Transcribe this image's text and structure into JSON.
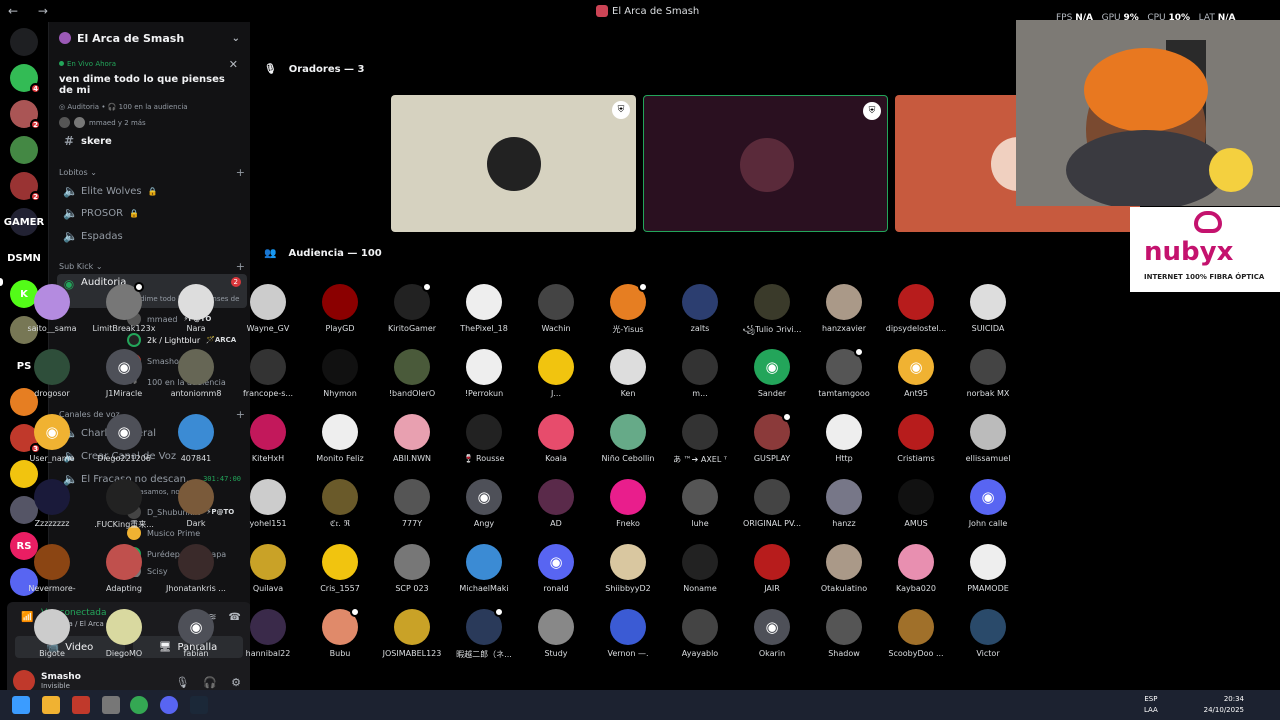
{
  "titlebar": {
    "title": "El Arca de Smash",
    "fps_label": "FPS",
    "fps_value": "N/A",
    "gpu_label": "GPU",
    "gpu_value": "9%",
    "cpu_label": "CPU",
    "cpu_value": "10%",
    "lat_label": "LAT",
    "lat_value": "N/A"
  },
  "servers": [
    {
      "abbr": "",
      "color": "#1e1f22",
      "badge": ""
    },
    {
      "abbr": "",
      "color": "#3b5",
      "badge": "4"
    },
    {
      "abbr": "",
      "color": "#a55",
      "badge": "2"
    },
    {
      "abbr": "",
      "color": "#484",
      "badge": ""
    },
    {
      "abbr": "",
      "color": "#933",
      "badge": "2"
    },
    {
      "abbr": "GAMER",
      "color": "#223",
      "badge": ""
    },
    {
      "abbr": "DSMN",
      "color": "#000",
      "badge": ""
    },
    {
      "abbr": "K",
      "color": "#53fc18",
      "badge": ""
    },
    {
      "abbr": "",
      "color": "#775",
      "badge": ""
    },
    {
      "abbr": "PS",
      "color": "#000",
      "badge": ""
    },
    {
      "abbr": "",
      "color": "#e67e22",
      "badge": ""
    },
    {
      "abbr": "",
      "color": "#c0392b",
      "badge": "3"
    },
    {
      "abbr": "",
      "color": "#f1c40f",
      "badge": ""
    },
    {
      "abbr": "",
      "color": "#556",
      "badge": ""
    },
    {
      "abbr": "RS",
      "color": "#e91e63",
      "badge": ""
    },
    {
      "abbr": "",
      "color": "#5865f2",
      "badge": ""
    },
    {
      "abbr": "",
      "color": "#8a6",
      "badge": ""
    }
  ],
  "guild": {
    "name": "El Arca de Smash"
  },
  "stage": {
    "live_label": "En Vivo Ahora",
    "topic": "ven dime todo lo que pienses de mi",
    "meta_channel": "Auditoria",
    "meta_audience": "100 en la audiencia",
    "users": "mmaed y 2 más"
  },
  "channels": {
    "skere": "skere",
    "cat_lobitos": "Lobitos",
    "elite": "Elite Wolves",
    "prosor": "PROSOR",
    "espadas": "Espadas",
    "cat_subkick": "Sub Kick",
    "auditoria": "Auditoria",
    "auditoria_count": "2",
    "auditoria_sub": "ven dime todo lo que pienses de mi",
    "m1_name": "mmaed",
    "m1_tag": "P@TO",
    "m2_name": "2k / Lightblur",
    "m2_tag": "ARCA",
    "m3_name": "Smasho",
    "m4_name": "100 en la audiencia",
    "cat_voz": "Canales de voz",
    "charla": "Charla General",
    "crear": "Crear Canal de Voz",
    "fracaso": "El Fracaso no descan...",
    "fracaso_time": "301:47:00",
    "fracaso_sub": "Fracasamos, no hay ATV",
    "v1_name": "D_ShubunkiN",
    "v1_tag": "P@TO",
    "v2_name": "Musico Prime",
    "v3_name": "Purédepapasinpapa",
    "v4_name": "Scisy"
  },
  "voice_panel": {
    "status": "Voz conectada",
    "location": "Auditoria / El Arca de Smash",
    "video": "Video",
    "screen": "Pantalla",
    "username": "Smasho",
    "user_status": "Invisible"
  },
  "main": {
    "speakers_header": "Oradores — 3",
    "audience_header": "Audiencia — 100",
    "speaker_tiles": [
      {
        "bg": "#d6d2c0",
        "avatar": "#222",
        "border": "none"
      },
      {
        "bg": "#2a1020",
        "avatar": "#5a2a3a",
        "border": "#23a55a"
      },
      {
        "bg": "#c75a3e",
        "avatar": "#f0d0c0",
        "border": "none"
      }
    ],
    "logo_name": "nubyx",
    "logo_tag": "INTERNET 100% FIBRA ÓPTICA"
  },
  "audience": [
    {
      "name": "saito__sama",
      "color": "#b48be0",
      "discord": false,
      "mark": false
    },
    {
      "name": "LimitBreak123x",
      "color": "#777",
      "discord": false,
      "mark": true
    },
    {
      "name": "Nara",
      "color": "#ddd",
      "discord": false,
      "mark": false
    },
    {
      "name": "Wayne_GV",
      "color": "#ccc",
      "discord": false,
      "mark": false
    },
    {
      "name": "PlayGD",
      "color": "#8b0000",
      "discord": false,
      "mark": false
    },
    {
      "name": "KiritoGamer",
      "color": "#222",
      "discord": false,
      "mark": true
    },
    {
      "name": "ThePixel_18",
      "color": "#eee",
      "discord": false,
      "mark": false
    },
    {
      "name": "Wachin",
      "color": "#444",
      "discord": false,
      "mark": false
    },
    {
      "name": "光-Yisus",
      "color": "#e67e22",
      "discord": false,
      "mark": true
    },
    {
      "name": "zalts",
      "color": "#2c3e70",
      "discord": false,
      "mark": false
    },
    {
      "name": "꧁Tulio ℑrivi...",
      "color": "#3a3a2a",
      "discord": false,
      "mark": false
    },
    {
      "name": "hanzxavier",
      "color": "#a98",
      "discord": false,
      "mark": false
    },
    {
      "name": "dipsydelostel...",
      "color": "#b71c1c",
      "discord": false,
      "mark": false
    },
    {
      "name": "SUICIDA",
      "color": "#ddd",
      "discord": false,
      "mark": false
    },
    {
      "name": "drogosor",
      "color": "#2e4e3a",
      "discord": false,
      "mark": false
    },
    {
      "name": "J1Miracle",
      "color": "#4e5058",
      "discord": true,
      "mark": false
    },
    {
      "name": "antoniomm8",
      "color": "#665",
      "discord": false,
      "mark": false
    },
    {
      "name": "francope-s...",
      "color": "#333",
      "discord": false,
      "mark": false
    },
    {
      "name": "Nhymon",
      "color": "#111",
      "discord": false,
      "mark": false
    },
    {
      "name": "!bandOlerO",
      "color": "#4a5a3a",
      "discord": false,
      "mark": false
    },
    {
      "name": "!Perrokun",
      "color": "#eee",
      "discord": false,
      "mark": false
    },
    {
      "name": "J...",
      "color": "#f1c40f",
      "discord": false,
      "mark": false
    },
    {
      "name": "Ken",
      "color": "#ddd",
      "discord": false,
      "mark": false
    },
    {
      "name": "m...",
      "color": "#333",
      "discord": false,
      "mark": false
    },
    {
      "name": "Sander",
      "color": "#23a55a",
      "discord": true,
      "mark": false
    },
    {
      "name": "tamtamgooo",
      "color": "#555",
      "discord": false,
      "mark": true
    },
    {
      "name": "Ant95",
      "color": "#f0b232",
      "discord": true,
      "mark": false
    },
    {
      "name": "norbak MX",
      "color": "#444",
      "discord": false,
      "mark": false
    },
    {
      "name": "User_name",
      "color": "#f0b232",
      "discord": true,
      "mark": false
    },
    {
      "name": "Diego221206",
      "color": "#4e5058",
      "discord": true,
      "mark": false
    },
    {
      "name": "407841",
      "color": "#3b8bd4",
      "discord": false,
      "mark": false
    },
    {
      "name": "KiteHxH",
      "color": "#c2185b",
      "discord": false,
      "mark": false
    },
    {
      "name": "Monito Feliz",
      "color": "#eee",
      "discord": false,
      "mark": false
    },
    {
      "name": "ABII.NWN",
      "color": "#e8a0b0",
      "discord": false,
      "mark": false
    },
    {
      "name": "🍷 Rousse",
      "color": "#222",
      "discord": false,
      "mark": false
    },
    {
      "name": "Koala",
      "color": "#e74c6c",
      "discord": false,
      "mark": false
    },
    {
      "name": "Niño Cebollin",
      "color": "#6a8",
      "discord": false,
      "mark": false
    },
    {
      "name": "あ ™➔ AXEL ᵀ",
      "color": "#333",
      "discord": false,
      "mark": false
    },
    {
      "name": "GUSPLAY",
      "color": "#8b3a3a",
      "discord": false,
      "mark": true
    },
    {
      "name": "Http",
      "color": "#eee",
      "discord": false,
      "mark": false
    },
    {
      "name": "Cristiams",
      "color": "#b71c1c",
      "discord": false,
      "mark": false
    },
    {
      "name": "ellissamuel",
      "color": "#bbb",
      "discord": false,
      "mark": false
    },
    {
      "name": "Zzzzzzzz",
      "color": "#1a1a3a",
      "discord": false,
      "mark": false
    },
    {
      "name": ".FUCKing重来...",
      "color": "#222",
      "discord": false,
      "mark": false
    },
    {
      "name": "Dark",
      "color": "#7a5a3a",
      "discord": false,
      "mark": false
    },
    {
      "name": "yohel151",
      "color": "#ccc",
      "discord": false,
      "mark": false
    },
    {
      "name": "ℭ𝔯. ℜ",
      "color": "#6a5a2a",
      "discord": false,
      "mark": false
    },
    {
      "name": "777Y",
      "color": "#555",
      "discord": false,
      "mark": false
    },
    {
      "name": "Angy",
      "color": "#4e5058",
      "discord": true,
      "mark": false
    },
    {
      "name": "AD",
      "color": "#5a2a4a",
      "discord": false,
      "mark": false
    },
    {
      "name": "Fneko",
      "color": "#e91e8c",
      "discord": false,
      "mark": false
    },
    {
      "name": "luhe",
      "color": "#555",
      "discord": false,
      "mark": false
    },
    {
      "name": "ORIGINAL PV...",
      "color": "#444",
      "discord": false,
      "mark": false
    },
    {
      "name": "hanzz",
      "color": "#778",
      "discord": false,
      "mark": false
    },
    {
      "name": "AMUS",
      "color": "#111",
      "discord": false,
      "mark": false
    },
    {
      "name": "John calle",
      "color": "#5865f2",
      "discord": true,
      "mark": false
    },
    {
      "name": "Nevermore-",
      "color": "#8b4513",
      "discord": false,
      "mark": false
    },
    {
      "name": "Adapting",
      "color": "#c0504d",
      "discord": false,
      "mark": false
    },
    {
      "name": "Jhonatankris ...",
      "color": "#3a2a2a",
      "discord": false,
      "mark": false
    },
    {
      "name": "Quilava",
      "color": "#c9a227",
      "discord": false,
      "mark": false
    },
    {
      "name": "Cris_1557",
      "color": "#f1c40f",
      "discord": false,
      "mark": false
    },
    {
      "name": "SCP 023",
      "color": "#777",
      "discord": false,
      "mark": false
    },
    {
      "name": "MichaelMaki",
      "color": "#3b8bd4",
      "discord": false,
      "mark": false
    },
    {
      "name": "ronald",
      "color": "#5865f2",
      "discord": true,
      "mark": false
    },
    {
      "name": "ShiibbyyD2",
      "color": "#d9c7a0",
      "discord": false,
      "mark": false
    },
    {
      "name": "Noname",
      "color": "#222",
      "discord": false,
      "mark": false
    },
    {
      "name": "JAIR",
      "color": "#b71c1c",
      "discord": false,
      "mark": false
    },
    {
      "name": "Otakulatino",
      "color": "#a98",
      "discord": false,
      "mark": false
    },
    {
      "name": "Kayba020",
      "color": "#e88fb0",
      "discord": false,
      "mark": false
    },
    {
      "name": "PMAMODE",
      "color": "#eee",
      "discord": false,
      "mark": false
    },
    {
      "name": "Bigote",
      "color": "#ccc",
      "discord": false,
      "mark": false
    },
    {
      "name": "DiegoMO",
      "color": "#d9d9a0",
      "discord": false,
      "mark": false
    },
    {
      "name": "fabian",
      "color": "#4e5058",
      "discord": true,
      "mark": false
    },
    {
      "name": "hannibal22",
      "color": "#3a2a4a",
      "discord": false,
      "mark": false
    },
    {
      "name": "Bubu",
      "color": "#e08a6a",
      "discord": false,
      "mark": true
    },
    {
      "name": "JOSIMABEL123",
      "color": "#c9a227",
      "discord": false,
      "mark": false
    },
    {
      "name": "暇越二郎（ネ...",
      "color": "#2a3a5a",
      "discord": false,
      "mark": true
    },
    {
      "name": "Study",
      "color": "#888",
      "discord": false,
      "mark": false
    },
    {
      "name": "Vernon —.",
      "color": "#3b5bd4",
      "discord": false,
      "mark": false
    },
    {
      "name": "Ayayablo",
      "color": "#444",
      "discord": false,
      "mark": false
    },
    {
      "name": "Okarin",
      "color": "#4e5058",
      "discord": true,
      "mark": false
    },
    {
      "name": "Shadow",
      "color": "#555",
      "discord": false,
      "mark": false
    },
    {
      "name": "ScoobyDoo ...",
      "color": "#a0702a",
      "discord": false,
      "mark": false
    },
    {
      "name": "Victor",
      "color": "#2a4a6a",
      "discord": false,
      "mark": false
    }
  ],
  "taskbar": {
    "lang1": "ESP",
    "lang2": "LAA",
    "time": "20:34",
    "date": "24/10/2025"
  }
}
